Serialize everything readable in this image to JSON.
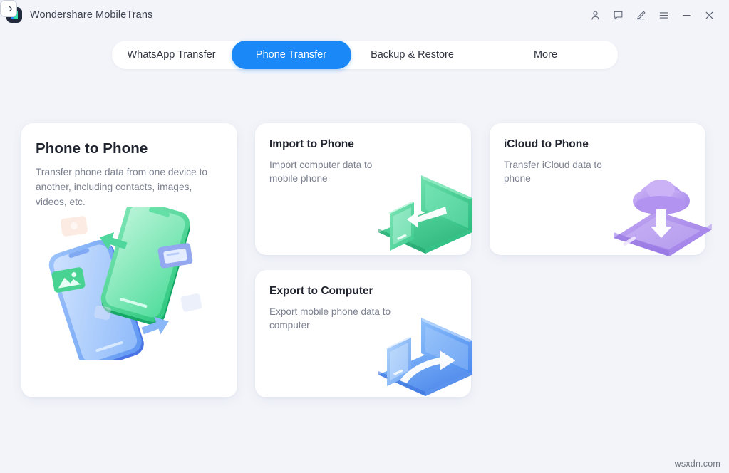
{
  "window": {
    "title": "Wondershare MobileTrans",
    "logo_icon": "mobiletrans-logo-icon",
    "controls": [
      {
        "name": "account-icon",
        "label": "Account"
      },
      {
        "name": "feedback-icon",
        "label": "Feedback"
      },
      {
        "name": "edit-pen-icon",
        "label": "Edit"
      },
      {
        "name": "menu-icon",
        "label": "Menu"
      },
      {
        "name": "minimize-icon",
        "label": "Minimize"
      },
      {
        "name": "close-icon",
        "label": "Close"
      }
    ]
  },
  "tabs": [
    {
      "label": "WhatsApp Transfer",
      "active": false
    },
    {
      "label": "Phone Transfer",
      "active": true
    },
    {
      "label": "Backup & Restore",
      "active": false
    },
    {
      "label": "More",
      "active": false
    }
  ],
  "cards": {
    "phone_to_phone": {
      "title": "Phone to Phone",
      "description": "Transfer phone data from one device to another, including contacts, images, videos, etc.",
      "arrow_icon": "arrow-right-icon",
      "illustration": "two-phones-transfer-illustration"
    },
    "import_to_phone": {
      "title": "Import to Phone",
      "description": "Import computer data to mobile phone",
      "arrow_icon": "arrow-right-icon",
      "illustration": "laptop-to-phone-green-illustration"
    },
    "icloud_to_phone": {
      "title": "iCloud to Phone",
      "description": "Transfer iCloud data to phone",
      "arrow_icon": "arrow-right-icon",
      "illustration": "cloud-to-phone-purple-illustration"
    },
    "export_to_computer": {
      "title": "Export to Computer",
      "description": "Export mobile phone data to computer",
      "arrow_icon": "arrow-right-icon",
      "illustration": "phone-to-laptop-blue-illustration"
    }
  },
  "watermark": "wsxdn.com",
  "colors": {
    "background": "#f2f4f9",
    "card": "#ffffff",
    "accent_blue": "#1a88f7",
    "title_text": "#20242f",
    "body_text": "#7b8190",
    "green": "#3fd18b",
    "purple": "#a98bea",
    "blue_illus": "#5b9cf5"
  }
}
